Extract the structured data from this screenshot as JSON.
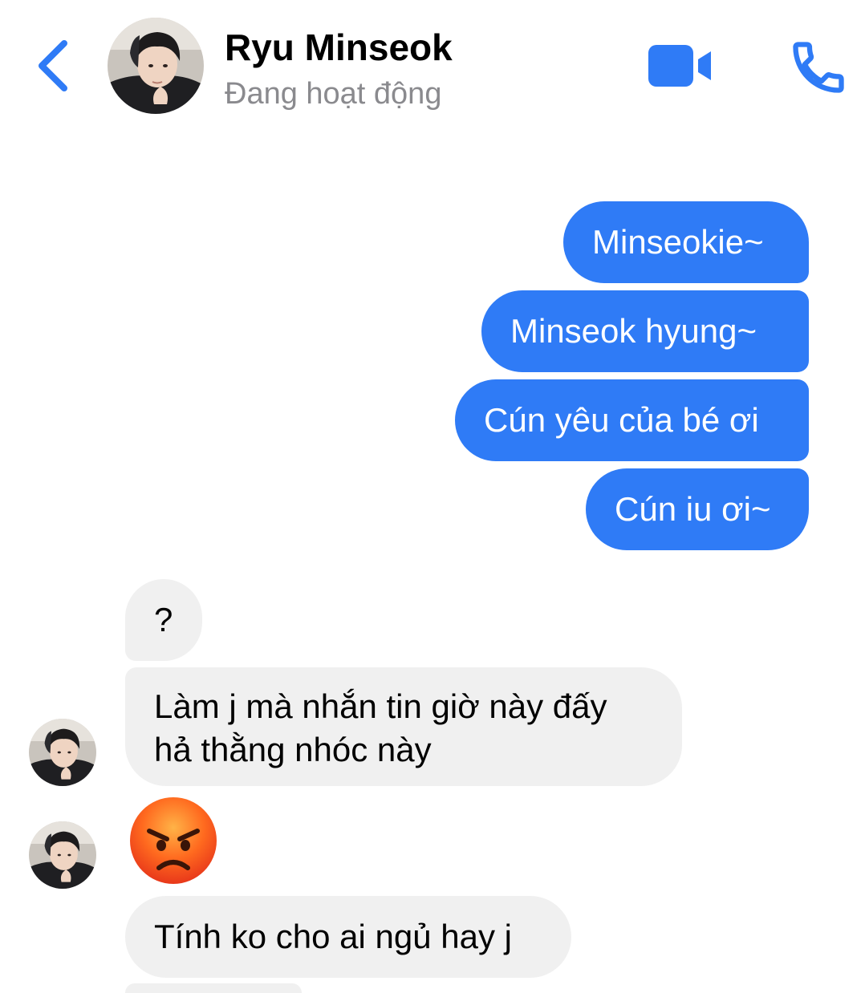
{
  "header": {
    "contact_name": "Ryu Minseok",
    "status": "Đang hoạt động",
    "back_icon": "chevron-left-icon",
    "video_icon": "video-camera-icon",
    "call_icon": "phone-icon"
  },
  "colors": {
    "accent": "#2f7bf6",
    "outgoing_bubble": "#2f7bf6",
    "incoming_bubble": "#f0f0f0",
    "status_text": "#8a8a8e"
  },
  "messages": {
    "outgoing": [
      "Minseokie~",
      "Minseok hyung~",
      "Cún yêu của bé ơi",
      "Cún iu ơi~"
    ],
    "incoming_1": "?",
    "incoming_2_line1": "Làm j mà nhắn tin giờ này đấy",
    "incoming_2_line2": "hả thằng nhóc này",
    "incoming_3_emoji": "angry-face-emoji",
    "incoming_4": "Tính ko cho ai ngủ hay j"
  }
}
